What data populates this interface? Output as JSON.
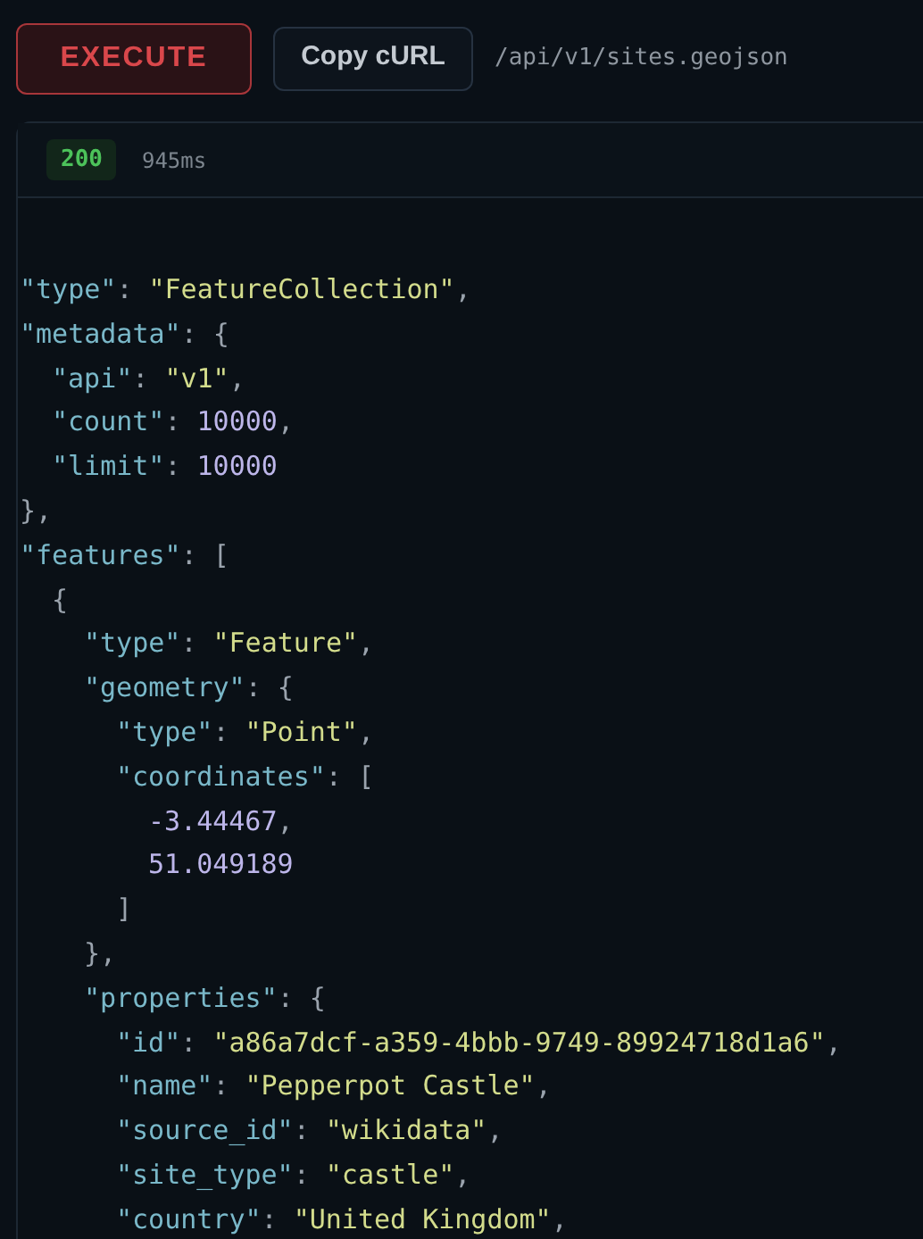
{
  "toolbar": {
    "execute_button": "EXECUTE",
    "copy_button": "Copy cURL",
    "endpoint": "/api/v1/sites.geojson"
  },
  "response": {
    "status": "200",
    "duration": "945ms",
    "lines": [
      {
        "tokens": [
          {
            "kind": "key",
            "text": "\"type\""
          },
          {
            "kind": "punct",
            "text": ": "
          },
          {
            "kind": "string",
            "text": "\"FeatureCollection\""
          },
          {
            "kind": "punct",
            "text": ","
          }
        ]
      },
      {
        "tokens": [
          {
            "kind": "key",
            "text": "\"metadata\""
          },
          {
            "kind": "punct",
            "text": ": {"
          }
        ],
        "children": [
          {
            "tokens": [
              {
                "kind": "key",
                "text": "\"api\""
              },
              {
                "kind": "punct",
                "text": ": "
              },
              {
                "kind": "string",
                "text": "\"v1\""
              },
              {
                "kind": "punct",
                "text": ","
              }
            ]
          },
          {
            "tokens": [
              {
                "kind": "key",
                "text": "\"count\""
              },
              {
                "kind": "punct",
                "text": ": "
              },
              {
                "kind": "number",
                "text": "10000"
              },
              {
                "kind": "punct",
                "text": ","
              }
            ]
          },
          {
            "tokens": [
              {
                "kind": "key",
                "text": "\"limit\""
              },
              {
                "kind": "punct",
                "text": ": "
              },
              {
                "kind": "number",
                "text": "10000"
              }
            ]
          }
        ]
      },
      {
        "tokens": [
          {
            "kind": "punct",
            "text": "},"
          }
        ]
      },
      {
        "tokens": [
          {
            "kind": "key",
            "text": "\"features\""
          },
          {
            "kind": "punct",
            "text": ": ["
          }
        ],
        "children": [
          {
            "tokens": [
              {
                "kind": "punct",
                "text": "{"
              }
            ],
            "children": [
              {
                "tokens": [
                  {
                    "kind": "key",
                    "text": "\"type\""
                  },
                  {
                    "kind": "punct",
                    "text": ": "
                  },
                  {
                    "kind": "string",
                    "text": "\"Feature\""
                  },
                  {
                    "kind": "punct",
                    "text": ","
                  }
                ]
              },
              {
                "tokens": [
                  {
                    "kind": "key",
                    "text": "\"geometry\""
                  },
                  {
                    "kind": "punct",
                    "text": ": {"
                  }
                ],
                "children": [
                  {
                    "tokens": [
                      {
                        "kind": "key",
                        "text": "\"type\""
                      },
                      {
                        "kind": "punct",
                        "text": ": "
                      },
                      {
                        "kind": "string",
                        "text": "\"Point\""
                      },
                      {
                        "kind": "punct",
                        "text": ","
                      }
                    ]
                  },
                  {
                    "tokens": [
                      {
                        "kind": "key",
                        "text": "\"coordinates\""
                      },
                      {
                        "kind": "punct",
                        "text": ": ["
                      }
                    ],
                    "children": [
                      {
                        "tokens": [
                          {
                            "kind": "number",
                            "text": "-3.44467"
                          },
                          {
                            "kind": "punct",
                            "text": ","
                          }
                        ]
                      },
                      {
                        "tokens": [
                          {
                            "kind": "number",
                            "text": "51.049189"
                          }
                        ]
                      }
                    ]
                  },
                  {
                    "tokens": [
                      {
                        "kind": "punct",
                        "text": "]"
                      }
                    ]
                  }
                ]
              },
              {
                "tokens": [
                  {
                    "kind": "punct",
                    "text": "},"
                  }
                ]
              },
              {
                "tokens": [
                  {
                    "kind": "key",
                    "text": "\"properties\""
                  },
                  {
                    "kind": "punct",
                    "text": ": {"
                  }
                ],
                "children": [
                  {
                    "tokens": [
                      {
                        "kind": "key",
                        "text": "\"id\""
                      },
                      {
                        "kind": "punct",
                        "text": ": "
                      },
                      {
                        "kind": "string",
                        "text": "\"a86a7dcf-a359-4bbb-9749-89924718d1a6\""
                      },
                      {
                        "kind": "punct",
                        "text": ","
                      }
                    ]
                  },
                  {
                    "tokens": [
                      {
                        "kind": "key",
                        "text": "\"name\""
                      },
                      {
                        "kind": "punct",
                        "text": ": "
                      },
                      {
                        "kind": "string",
                        "text": "\"Pepperpot Castle\""
                      },
                      {
                        "kind": "punct",
                        "text": ","
                      }
                    ]
                  },
                  {
                    "tokens": [
                      {
                        "kind": "key",
                        "text": "\"source_id\""
                      },
                      {
                        "kind": "punct",
                        "text": ": "
                      },
                      {
                        "kind": "string",
                        "text": "\"wikidata\""
                      },
                      {
                        "kind": "punct",
                        "text": ","
                      }
                    ]
                  },
                  {
                    "tokens": [
                      {
                        "kind": "key",
                        "text": "\"site_type\""
                      },
                      {
                        "kind": "punct",
                        "text": ": "
                      },
                      {
                        "kind": "string",
                        "text": "\"castle\""
                      },
                      {
                        "kind": "punct",
                        "text": ","
                      }
                    ]
                  },
                  {
                    "tokens": [
                      {
                        "kind": "key",
                        "text": "\"country\""
                      },
                      {
                        "kind": "punct",
                        "text": ": "
                      },
                      {
                        "kind": "string",
                        "text": "\"United Kingdom\""
                      },
                      {
                        "kind": "punct",
                        "text": ","
                      }
                    ]
                  }
                ]
              }
            ]
          }
        ]
      }
    ]
  }
}
